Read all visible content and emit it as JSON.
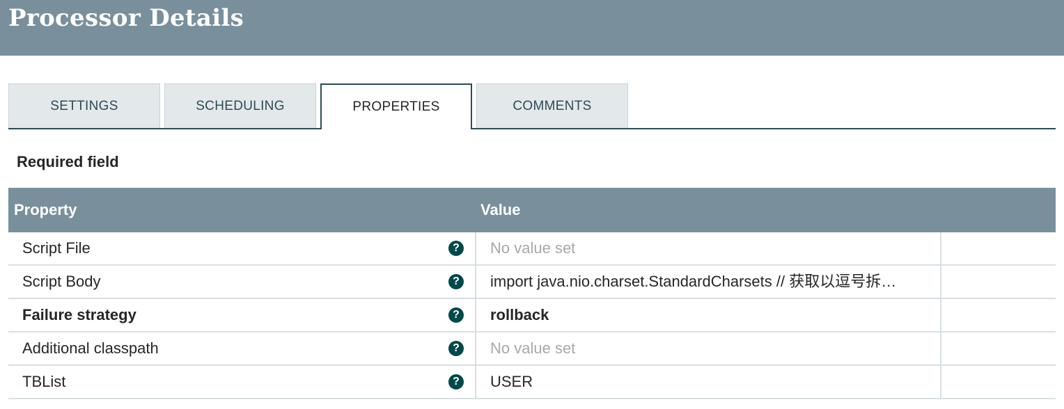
{
  "header": {
    "title": "Processor Details"
  },
  "tabs": [
    {
      "label": "SETTINGS"
    },
    {
      "label": "SCHEDULING"
    },
    {
      "label": "PROPERTIES"
    },
    {
      "label": "COMMENTS"
    }
  ],
  "active_tab": "PROPERTIES",
  "required_label": "Required field",
  "table": {
    "headers": {
      "property": "Property",
      "value": "Value"
    },
    "rows": [
      {
        "property": "Script File",
        "value": "No value set",
        "required": false,
        "empty": true
      },
      {
        "property": "Script Body",
        "value": "import java.nio.charset.StandardCharsets // 获取以逗号拆…",
        "required": false,
        "empty": false
      },
      {
        "property": "Failure strategy",
        "value": "rollback",
        "required": true,
        "empty": false
      },
      {
        "property": "Additional classpath",
        "value": "No value set",
        "required": false,
        "empty": true
      },
      {
        "property": "TBList",
        "value": "USER",
        "required": false,
        "empty": false
      }
    ]
  },
  "colors": {
    "header_bg": "#798f9c",
    "tab_active_border": "#2e4a55",
    "help_icon": "#004849",
    "empty_value": "#a8a8a8"
  },
  "icons": {
    "help": "question-circle-icon"
  }
}
